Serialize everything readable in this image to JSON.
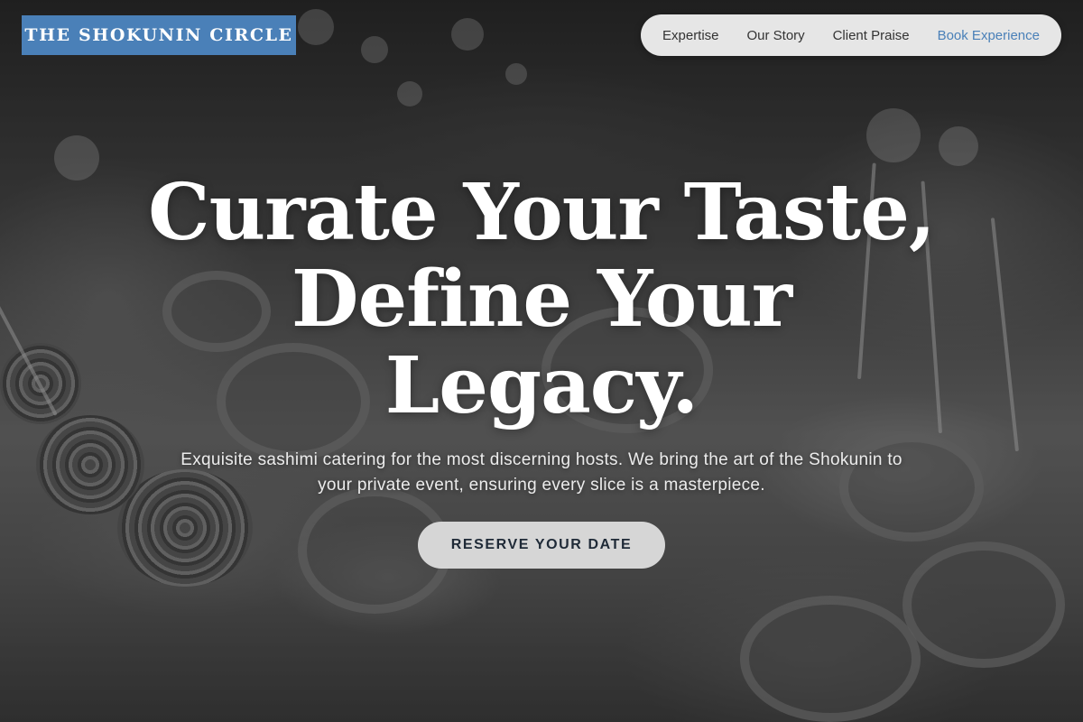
{
  "header": {
    "logo_text": "THE SHOKUNIN CIRCLE",
    "nav": [
      {
        "label": "Expertise"
      },
      {
        "label": "Our Story"
      },
      {
        "label": "Client Praise"
      },
      {
        "label": "Book Experience"
      }
    ]
  },
  "hero": {
    "title_lines": [
      "Curate Your Taste,",
      "Define Your",
      "Legacy."
    ],
    "subtitle": "Exquisite sashimi catering for the most discerning hosts. We bring the art of the Shokunin to your private event, ensuring every slice is a masterpiece.",
    "cta_label": "RESERVE YOUR DATE"
  },
  "colors": {
    "brand_blue": "#4a80b8",
    "nav_bg": "#f2f2f2",
    "cta_bg": "#d6d6d6",
    "cta_text": "#1f2a37"
  }
}
